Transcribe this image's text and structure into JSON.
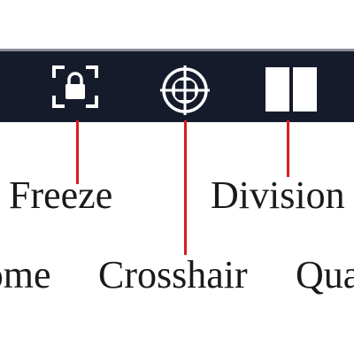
{
  "toolbar": {
    "buttons": [
      {
        "id": "freeze",
        "icon": "freeze-lock-icon"
      },
      {
        "id": "crosshair",
        "icon": "crosshair-icon"
      },
      {
        "id": "division",
        "icon": "division-split-icon"
      }
    ]
  },
  "callouts": {
    "freeze": "Freeze",
    "division": "Division",
    "home": "Home",
    "crosshair": "Crosshair",
    "quad": "Quad"
  },
  "colors": {
    "toolbar_bg": "#161b2c",
    "icon": "#ffffff",
    "pointer": "#d81d1d",
    "text": "#1a1a1a"
  }
}
